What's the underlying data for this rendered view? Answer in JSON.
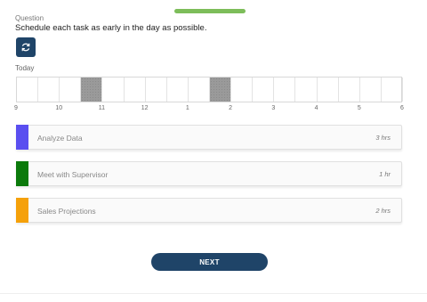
{
  "question": {
    "label": "Question",
    "text": "Schedule each task as early in the day as possible."
  },
  "reset_button": {
    "icon": "refresh-icon"
  },
  "timeline": {
    "label": "Today",
    "hour_labels": [
      "9",
      "10",
      "11",
      "12",
      "1",
      "2",
      "3",
      "4",
      "5",
      "6"
    ],
    "slot_count": 18,
    "blocked_slots": [
      3,
      9
    ]
  },
  "tasks": [
    {
      "name": "Analyze Data",
      "duration": "3 hrs",
      "color": "#5a4ff0"
    },
    {
      "name": "Meet with Supervisor",
      "duration": "1 hr",
      "color": "#0b7a0b"
    },
    {
      "name": "Sales Projections",
      "duration": "2 hrs",
      "color": "#f5a10a"
    }
  ],
  "next_button": {
    "label": "NEXT"
  },
  "colors": {
    "accent": "#1f4468",
    "progress": "#7dbd5a",
    "blocked": "#9a9a9a"
  }
}
